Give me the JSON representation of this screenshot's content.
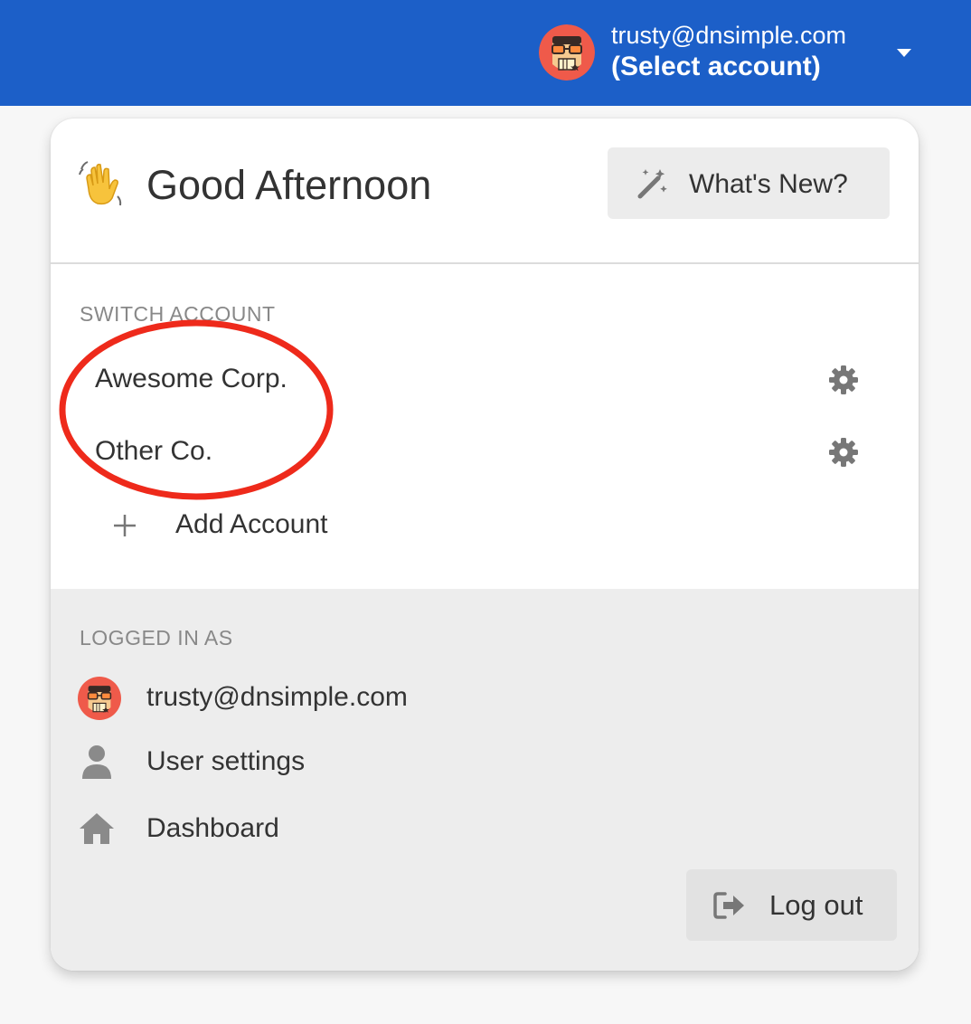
{
  "header": {
    "account_email": "trusty@dnsimple.com",
    "account_select_label": "(Select account)",
    "avatar_icon": "robot-avatar-icon",
    "caret_icon": "caret-down-icon",
    "background_color": "#1c5fc8"
  },
  "card": {
    "greeting_emoji": "waving-hand-icon",
    "greeting": "Good Afternoon",
    "whats_new_label": "What's New?",
    "whats_new_icon": "magic-wand-icon",
    "switch_account_heading": "SWITCH ACCOUNT",
    "accounts": [
      {
        "name": "Awesome Corp.",
        "settings_icon": "gear-icon"
      },
      {
        "name": "Other Co.",
        "settings_icon": "gear-icon"
      }
    ],
    "add_account_label": "Add Account",
    "annotation_color": "#ee2a1b"
  },
  "footer": {
    "logged_in_heading": "LOGGED IN AS",
    "user_email": "trusty@dnsimple.com",
    "user_settings_label": "User settings",
    "dashboard_label": "Dashboard",
    "logout_label": "Log out",
    "logout_icon": "sign-out-icon"
  }
}
